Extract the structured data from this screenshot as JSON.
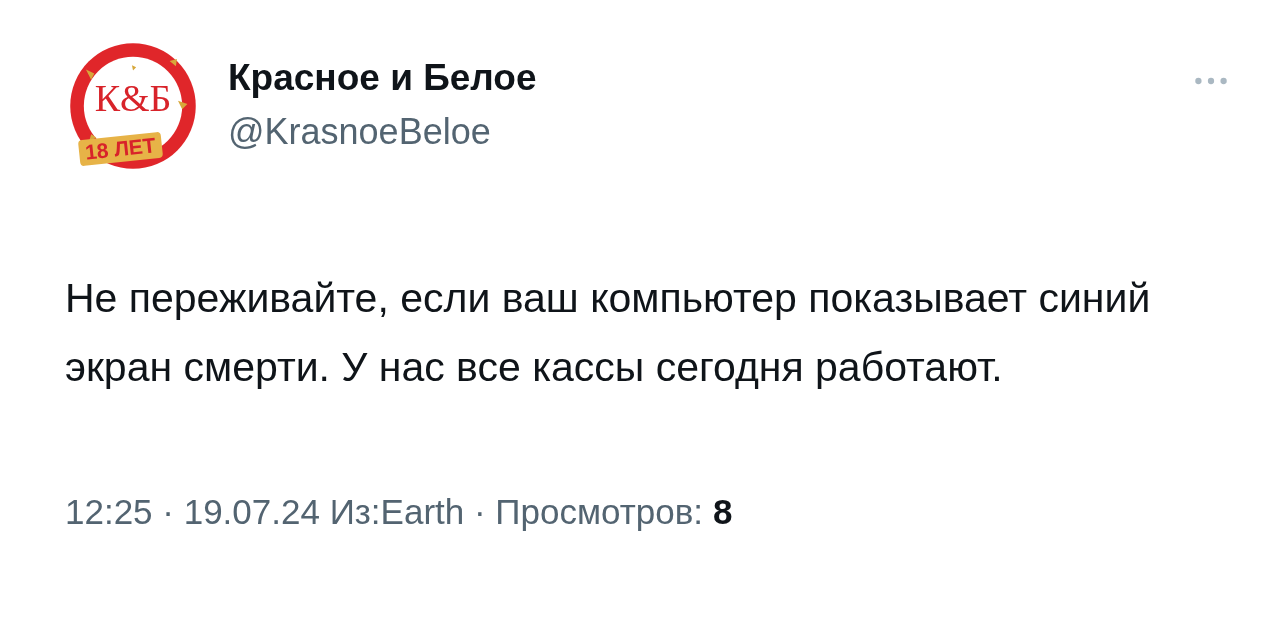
{
  "author": {
    "avatar": {
      "logo": "К&Б",
      "badge": "18 ЛЕТ"
    },
    "name": "Красное и Белое",
    "handle": "@KrasnoeBeloe"
  },
  "text": "Не переживайте, если ваш компьютер показывает синий экран смерти. У нас все кассы сегодня работают.",
  "meta": "12:25 · 19.07.24 Из:Earth · Просмотров:",
  "views": "8"
}
